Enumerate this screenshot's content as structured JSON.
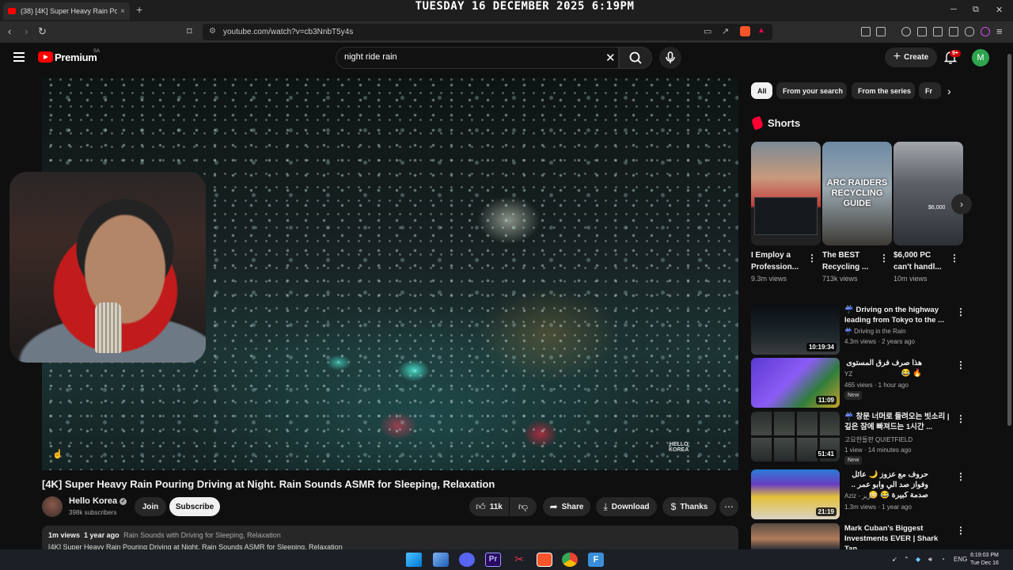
{
  "browser": {
    "tab_title": "(38) [4K] Super Heavy Rain Pouring",
    "tab_close": "×",
    "new_tab": "+",
    "url": "youtube.com/watch?v=cb3NnbT5y4s",
    "clock_overlay": "TUESDAY 16 DECEMBER 2025 6:19PM"
  },
  "header": {
    "brand": "Premium",
    "region": "SA",
    "search_value": "night ride rain",
    "create_label": "Create",
    "notification_count": "9+",
    "avatar_letter": "M"
  },
  "video": {
    "watermark_line1": "HELLO",
    "watermark_line2": "KOREA",
    "title": "[4K] Super Heavy Rain Pouring Driving at Night. Rain Sounds ASMR for Sleeping, Relaxation",
    "channel": "Hello Korea",
    "subscribers": "398k subscribers",
    "join_label": "Join",
    "subscribe_label": "Subscribe",
    "likes": "11k",
    "share_label": "Share",
    "download_label": "Download",
    "thanks_label": "Thanks",
    "views": "1m views",
    "age": "1 year ago",
    "playlist_tag": "Rain Sounds with Driving for Sleeping, Relaxation",
    "description_line": "[4K] Super Heavy Rain Pouring Driving at Night. Rain Sounds ASMR for Sleeping, Relaxation"
  },
  "chips": [
    "All",
    "From your search",
    "From the series",
    "Fr"
  ],
  "shorts": {
    "heading": "Shorts",
    "items": [
      {
        "title": "I Employ a Profession...",
        "views": "9.3m views"
      },
      {
        "title": "The BEST Recycling ...",
        "views": "713k views",
        "overlay": "ARC RAIDERS RECYCLING GUIDE"
      },
      {
        "title": "$6,000 PC can't handl...",
        "views": "10m views",
        "overlay": "$6,000"
      }
    ]
  },
  "recommendations": [
    {
      "title": "☔ Driving on the highway leading from Tokyo to the ...",
      "channel": "☔ Driving in the Rain",
      "meta": "4.3m views · 2 years ago",
      "duration": "10:19:34",
      "badge": ""
    },
    {
      "title": "هذا صرف فرق المستوى 🔥 😂",
      "channel": "YZ",
      "meta": "465 views · 1 hour ago",
      "duration": "11:09",
      "badge": "New"
    },
    {
      "title": "☔ 창문 너머로 들려오는 빗소리 | 깊은 잠에 빠져드는 1시간 ...",
      "channel": "고요한들판 QUIETFIELD",
      "meta": "1 view · 14 minutes ago",
      "duration": "51:41",
      "badge": "New"
    },
    {
      "title": "حروف مع عزوز 🌙 عائل وفواز صد الي وابو عمر .. صدمة كبيرة 😂 😳",
      "channel": "Aziz - عزيز",
      "meta": "1.3m views · 1 year ago",
      "duration": "21:19",
      "badge": ""
    },
    {
      "title": "Mark Cuban's Biggest Investments EVER | Shark Tan...",
      "channel": "",
      "meta": "",
      "duration": "",
      "badge": ""
    }
  ],
  "taskbar": {
    "lang": "ENG",
    "time": "6:19:03 PM",
    "date": "Tue Dec 16"
  },
  "colors": {
    "youtube_red": "#ff0000",
    "background": "#0f0f0f",
    "chip_bg": "#272727",
    "avatar_green": "#2ea44f"
  }
}
